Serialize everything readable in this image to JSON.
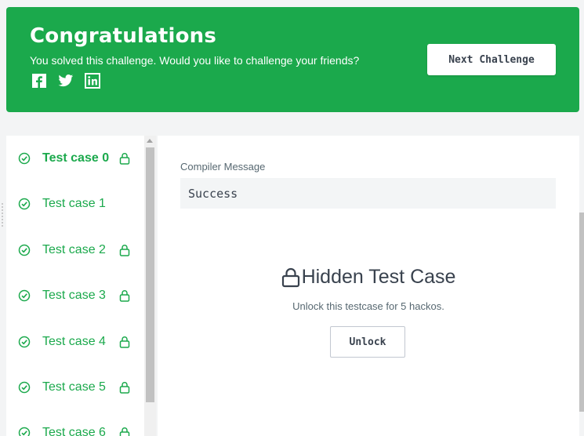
{
  "banner": {
    "title": "Congratulations",
    "subtitle": "You solved this challenge. Would you like to challenge your friends?",
    "next_label": "Next Challenge",
    "color": "#1ba94c",
    "social_icons": [
      "facebook-icon",
      "twitter-icon",
      "linkedin-icon"
    ]
  },
  "sidebar": {
    "items": [
      {
        "label": "Test case 0",
        "locked": true,
        "active": true
      },
      {
        "label": "Test case 1",
        "locked": false,
        "active": false
      },
      {
        "label": "Test case 2",
        "locked": true,
        "active": false
      },
      {
        "label": "Test case 3",
        "locked": true,
        "active": false
      },
      {
        "label": "Test case 4",
        "locked": true,
        "active": false
      },
      {
        "label": "Test case 5",
        "locked": true,
        "active": false
      },
      {
        "label": "Test case 6",
        "locked": true,
        "active": false
      }
    ]
  },
  "panel": {
    "compiler_label": "Compiler Message",
    "compiler_value": "Success",
    "hidden_title": "Hidden Test Case",
    "unlock_text": "Unlock this testcase for 5 hackos.",
    "unlock_label": "Unlock"
  }
}
